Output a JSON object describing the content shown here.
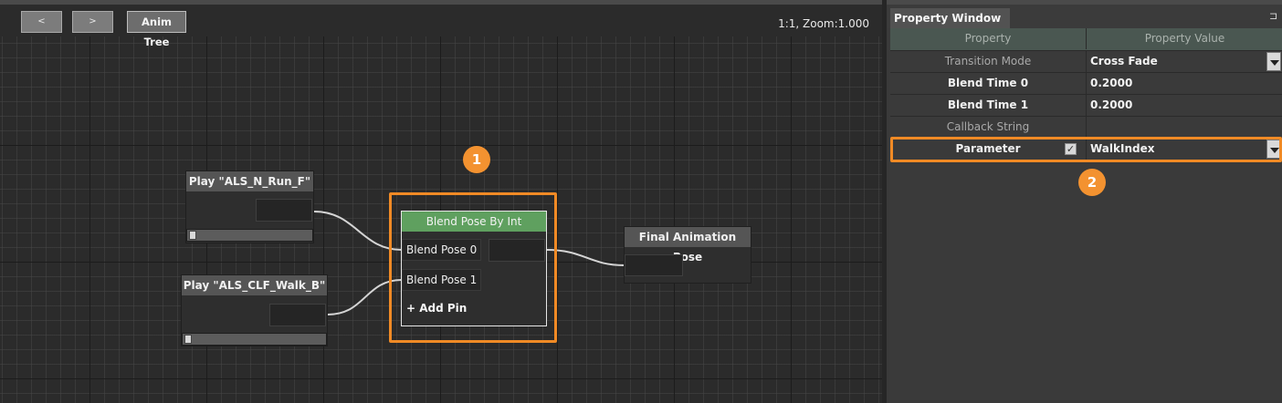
{
  "graph": {
    "toolbar": {
      "back_label": "<",
      "forward_label": ">",
      "anim_tree_label": "Anim Tree",
      "zoom_text": "1:1, Zoom:1.000"
    },
    "nodes": {
      "play_run": {
        "title": "Play \"ALS_N_Run_F\""
      },
      "play_walk": {
        "title": "Play \"ALS_CLF_Walk_B\""
      },
      "blend": {
        "title": "Blend Pose By Int",
        "pins": [
          "Blend Pose 0",
          "Blend Pose 1"
        ],
        "add_pin": "+ Add Pin",
        "title_color": "#5fa05f"
      },
      "final": {
        "title": "Final Animation Pose"
      }
    },
    "badge_1": "1"
  },
  "property_window": {
    "tab_title": "Property Window",
    "header": {
      "property": "Property",
      "value": "Property Value"
    },
    "rows": [
      {
        "name": "Transition Mode",
        "value": "Cross Fade"
      },
      {
        "name": "Blend Time 0",
        "value": "0.2000"
      },
      {
        "name": "Blend Time 1",
        "value": "0.2000"
      },
      {
        "name": "Callback String",
        "value": ""
      },
      {
        "name": "Parameter",
        "value": "WalkIndex",
        "checked": true
      }
    ],
    "badge_2": "2"
  },
  "colors": {
    "highlight": "#f08a25",
    "badge": "#f39230"
  }
}
